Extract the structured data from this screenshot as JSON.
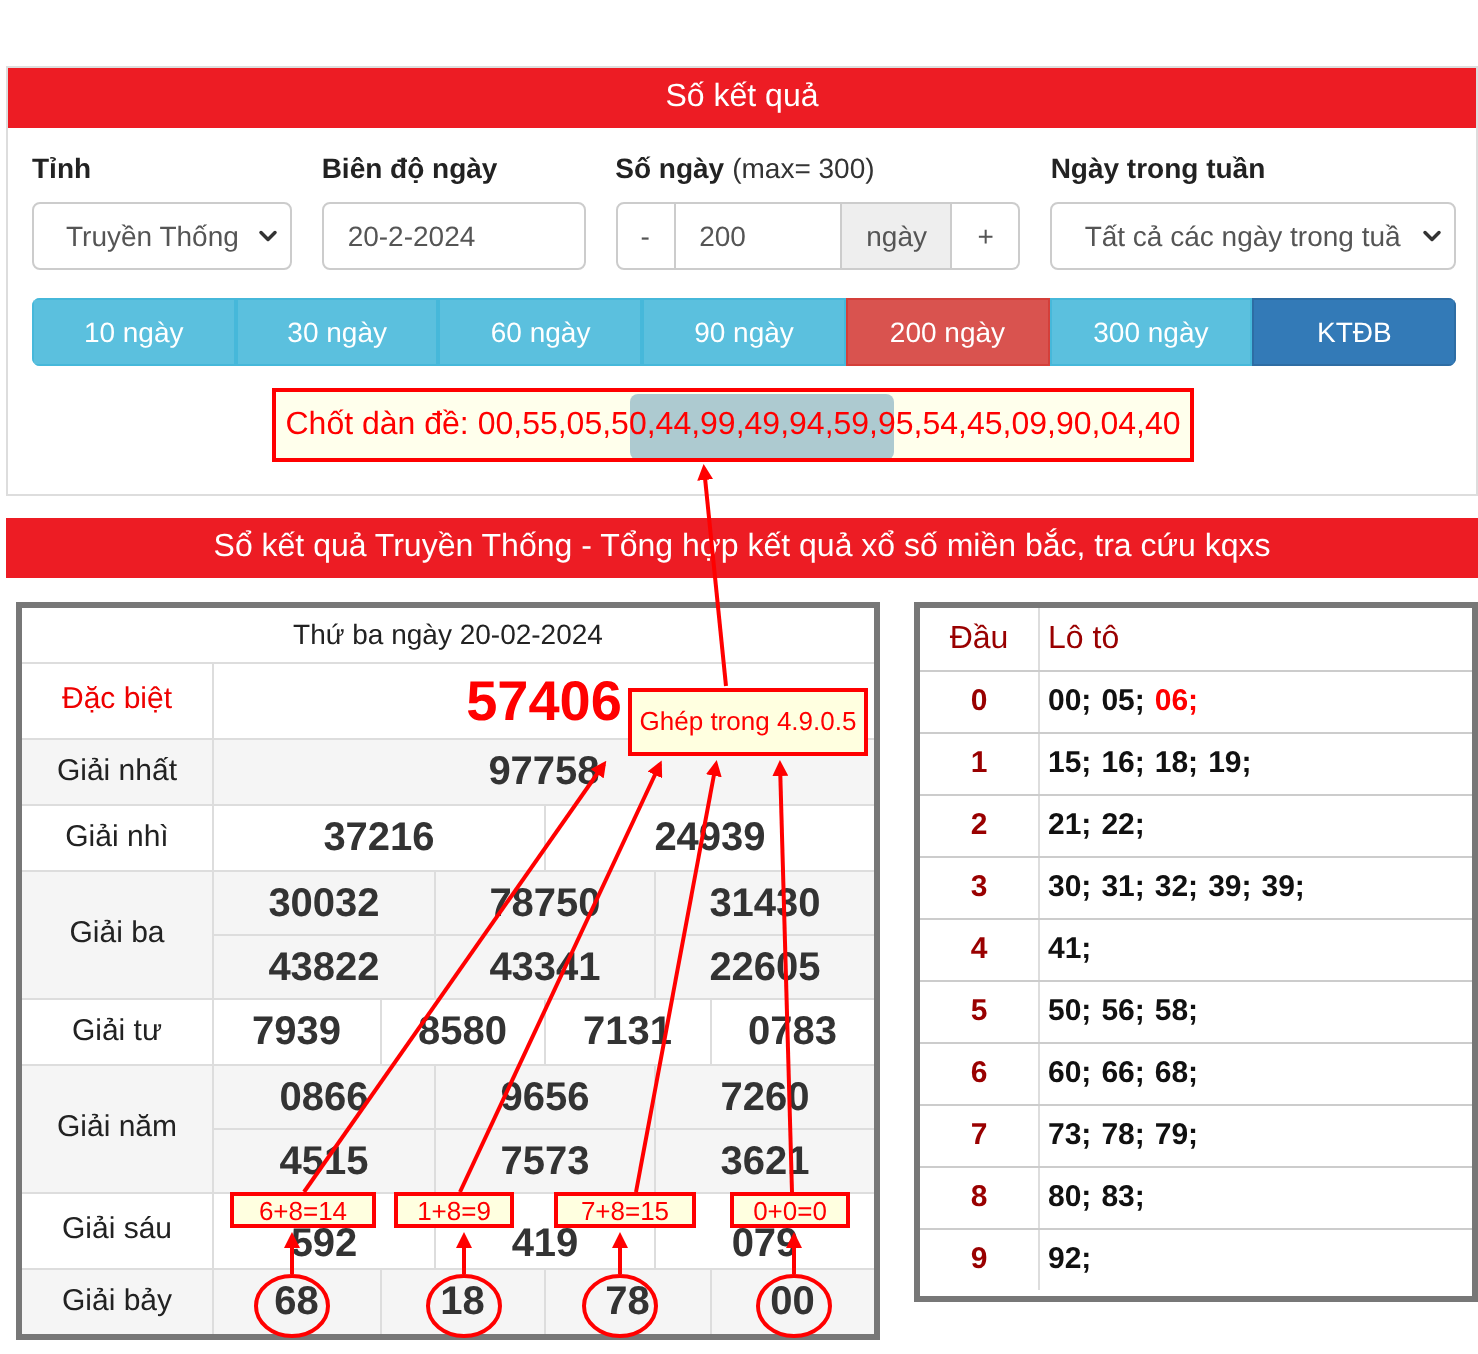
{
  "search_panel": {
    "title": "Số kết quả",
    "fields": [
      {
        "kind": "select",
        "label": "Tỉnh",
        "value": "Truyền Thống"
      },
      {
        "kind": "text",
        "label": "Biên độ ngày",
        "value": "20-2-2024"
      },
      {
        "kind": "stepper",
        "label": "Số ngày",
        "hint": "(max= 300)",
        "minus": "-",
        "value": "200",
        "unit": "ngày",
        "plus": "+"
      },
      {
        "kind": "select",
        "label": "Ngày trong tuần",
        "value": "Tất cả các ngày trong tuầ"
      }
    ],
    "range_buttons": [
      {
        "kind": "range",
        "label": "10 ngày",
        "selected": false
      },
      {
        "kind": "range",
        "label": "30 ngày",
        "selected": false
      },
      {
        "kind": "range",
        "label": "60 ngày",
        "selected": false
      },
      {
        "kind": "range",
        "label": "90 ngày",
        "selected": false
      },
      {
        "kind": "range",
        "label": "200 ngày",
        "selected": true
      },
      {
        "kind": "range",
        "label": "300 ngày",
        "selected": false
      },
      {
        "kind": "action",
        "label": "KTĐB",
        "selected": false
      }
    ],
    "summary": "Chốt dàn đề: 00,55,05,50,44,99,49,94,59,95,54,45,09,90,04,40"
  },
  "results": {
    "title": "Sổ kết quả Truyền Thống - Tổng hợp kết quả xổ số miền bắc, tra cứu kqxs",
    "date": "Thứ ba ngày 20-02-2024",
    "prizes": [
      {
        "kind": "special",
        "name": "Đặc biệt",
        "numbers": [
          "57406"
        ]
      },
      {
        "kind": "normal",
        "name": "Giải nhất",
        "numbers": [
          "97758"
        ]
      },
      {
        "kind": "normal",
        "name": "Giải nhì",
        "numbers": [
          "37216",
          "24939"
        ]
      },
      {
        "kind": "normal",
        "name": "Giải ba",
        "numbers": [
          "30032",
          "78750",
          "31430",
          "43822",
          "43341",
          "22605"
        ]
      },
      {
        "kind": "normal",
        "name": "Giải tư",
        "numbers": [
          "7939",
          "8580",
          "7131",
          "0783"
        ]
      },
      {
        "kind": "normal",
        "name": "Giải năm",
        "numbers": [
          "0866",
          "9656",
          "7260",
          "4515",
          "7573",
          "3621"
        ]
      },
      {
        "kind": "normal",
        "name": "Giải sáu",
        "numbers": [
          "592",
          "419",
          "079"
        ]
      },
      {
        "kind": "normal",
        "name": "Giải bảy",
        "numbers": [
          "68",
          "18",
          "78",
          "00"
        ]
      }
    ]
  },
  "loto": {
    "columns": [
      "Đầu",
      "Lô tô"
    ],
    "rows": [
      {
        "head": "0",
        "items": [
          {
            "text": "00;",
            "highlight": false
          },
          {
            "text": "05;",
            "highlight": false
          },
          {
            "text": "06;",
            "highlight": true
          }
        ]
      },
      {
        "head": "1",
        "items": [
          {
            "text": "15;",
            "highlight": false
          },
          {
            "text": "16;",
            "highlight": false
          },
          {
            "text": "18;",
            "highlight": false
          },
          {
            "text": "19;",
            "highlight": false
          }
        ]
      },
      {
        "head": "2",
        "items": [
          {
            "text": "21;",
            "highlight": false
          },
          {
            "text": "22;",
            "highlight": false
          }
        ]
      },
      {
        "head": "3",
        "items": [
          {
            "text": "30;",
            "highlight": false
          },
          {
            "text": "31;",
            "highlight": false
          },
          {
            "text": "32;",
            "highlight": false
          },
          {
            "text": "39;",
            "highlight": false
          },
          {
            "text": "39;",
            "highlight": false
          }
        ]
      },
      {
        "head": "4",
        "items": [
          {
            "text": "41;",
            "highlight": false
          }
        ]
      },
      {
        "head": "5",
        "items": [
          {
            "text": "50;",
            "highlight": false
          },
          {
            "text": "56;",
            "highlight": false
          },
          {
            "text": "58;",
            "highlight": false
          }
        ]
      },
      {
        "head": "6",
        "items": [
          {
            "text": "60;",
            "highlight": false
          },
          {
            "text": "66;",
            "highlight": false
          },
          {
            "text": "68;",
            "highlight": false
          }
        ]
      },
      {
        "head": "7",
        "items": [
          {
            "text": "73;",
            "highlight": false
          },
          {
            "text": "78;",
            "highlight": false
          },
          {
            "text": "79;",
            "highlight": false
          }
        ]
      },
      {
        "head": "8",
        "items": [
          {
            "text": "80;",
            "highlight": false
          },
          {
            "text": "83;",
            "highlight": false
          }
        ]
      },
      {
        "head": "9",
        "items": [
          {
            "text": "92;",
            "highlight": false
          }
        ]
      }
    ]
  },
  "annotations": {
    "combine_note": "Ghép trong 4.9.0.5",
    "sums": [
      "6+8=14",
      "1+8=9",
      "7+8=15",
      "0+0=0"
    ]
  }
}
